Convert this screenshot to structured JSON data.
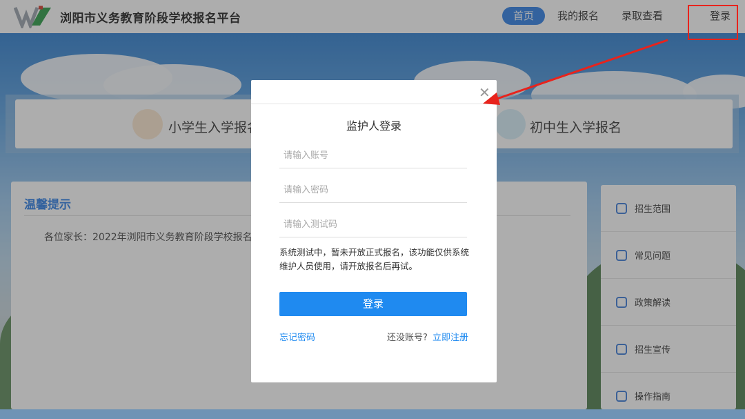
{
  "header": {
    "title": "浏阳市义务教育阶段学校报名平台",
    "nav": [
      {
        "label": "首页",
        "active": true
      },
      {
        "label": "我的报名",
        "active": false
      },
      {
        "label": "录取查看",
        "active": false
      },
      {
        "label": "登录",
        "active": false
      }
    ]
  },
  "entries": {
    "primary": "小学生入学报名",
    "middle": "初中生入学报名"
  },
  "notice": {
    "title": "温馨提示",
    "text": "各位家长：2022年浏阳市义务教育阶段学校报名"
  },
  "sidebar": {
    "items": [
      {
        "label": "招生范围",
        "icon": "location-icon"
      },
      {
        "label": "常见问题",
        "icon": "question-icon"
      },
      {
        "label": "政策解读",
        "icon": "policy-icon"
      },
      {
        "label": "招生宣传",
        "icon": "broadcast-icon"
      },
      {
        "label": "操作指南",
        "icon": "guide-icon"
      }
    ]
  },
  "modal": {
    "title": "监护人登录",
    "account_placeholder": "请输入账号",
    "password_placeholder": "请输入密码",
    "code_placeholder": "请输入测试码",
    "note": "系统测试中，暂未开放正式报名，该功能仅供系统维护人员使用，请开放报名后再试。",
    "login_label": "登录",
    "forgot_label": "忘记密码",
    "no_account_label": "还没账号?",
    "register_label": "立即注册"
  },
  "colors": {
    "accent": "#1f8af0",
    "nav_active": "#2d7fe6",
    "annotation": "#e8231c"
  }
}
